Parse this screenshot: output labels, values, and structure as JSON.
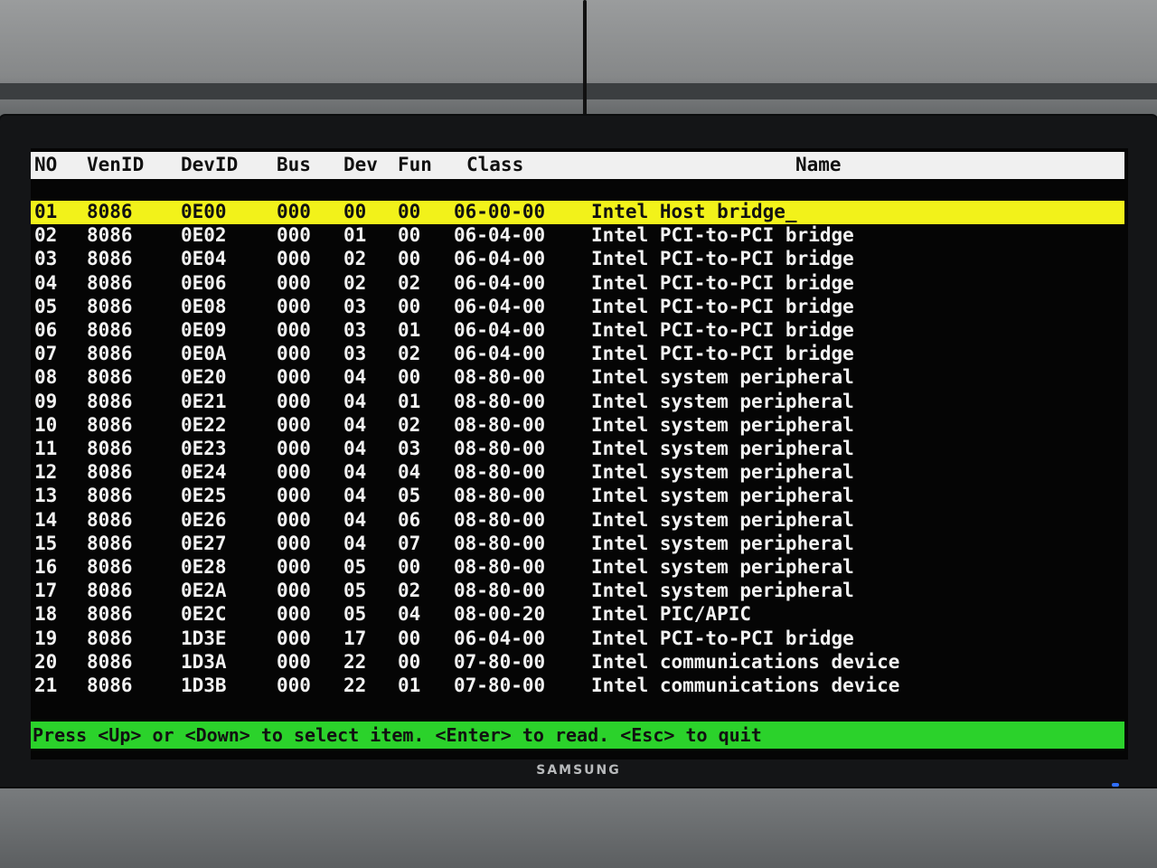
{
  "monitor": {
    "brand": "SAMSUNG"
  },
  "table": {
    "headers": {
      "no": "NO",
      "ven": "VenID",
      "dev": "DevID",
      "bus": "Bus",
      "devno": "Dev",
      "fun": "Fun",
      "class": "Class",
      "name": "Name"
    },
    "selected_index": 0,
    "rows": [
      {
        "no": "01",
        "ven": "8086",
        "dev": "0E00",
        "bus": "000",
        "devno": "00",
        "fun": "00",
        "class": "06-00-00",
        "name": "Intel Host bridge_"
      },
      {
        "no": "02",
        "ven": "8086",
        "dev": "0E02",
        "bus": "000",
        "devno": "01",
        "fun": "00",
        "class": "06-04-00",
        "name": "Intel PCI-to-PCI bridge"
      },
      {
        "no": "03",
        "ven": "8086",
        "dev": "0E04",
        "bus": "000",
        "devno": "02",
        "fun": "00",
        "class": "06-04-00",
        "name": "Intel PCI-to-PCI bridge"
      },
      {
        "no": "04",
        "ven": "8086",
        "dev": "0E06",
        "bus": "000",
        "devno": "02",
        "fun": "02",
        "class": "06-04-00",
        "name": "Intel PCI-to-PCI bridge"
      },
      {
        "no": "05",
        "ven": "8086",
        "dev": "0E08",
        "bus": "000",
        "devno": "03",
        "fun": "00",
        "class": "06-04-00",
        "name": "Intel PCI-to-PCI bridge"
      },
      {
        "no": "06",
        "ven": "8086",
        "dev": "0E09",
        "bus": "000",
        "devno": "03",
        "fun": "01",
        "class": "06-04-00",
        "name": "Intel PCI-to-PCI bridge"
      },
      {
        "no": "07",
        "ven": "8086",
        "dev": "0E0A",
        "bus": "000",
        "devno": "03",
        "fun": "02",
        "class": "06-04-00",
        "name": "Intel PCI-to-PCI bridge"
      },
      {
        "no": "08",
        "ven": "8086",
        "dev": "0E20",
        "bus": "000",
        "devno": "04",
        "fun": "00",
        "class": "08-80-00",
        "name": "Intel system peripheral"
      },
      {
        "no": "09",
        "ven": "8086",
        "dev": "0E21",
        "bus": "000",
        "devno": "04",
        "fun": "01",
        "class": "08-80-00",
        "name": "Intel system peripheral"
      },
      {
        "no": "10",
        "ven": "8086",
        "dev": "0E22",
        "bus": "000",
        "devno": "04",
        "fun": "02",
        "class": "08-80-00",
        "name": "Intel system peripheral"
      },
      {
        "no": "11",
        "ven": "8086",
        "dev": "0E23",
        "bus": "000",
        "devno": "04",
        "fun": "03",
        "class": "08-80-00",
        "name": "Intel system peripheral"
      },
      {
        "no": "12",
        "ven": "8086",
        "dev": "0E24",
        "bus": "000",
        "devno": "04",
        "fun": "04",
        "class": "08-80-00",
        "name": "Intel system peripheral"
      },
      {
        "no": "13",
        "ven": "8086",
        "dev": "0E25",
        "bus": "000",
        "devno": "04",
        "fun": "05",
        "class": "08-80-00",
        "name": "Intel system peripheral"
      },
      {
        "no": "14",
        "ven": "8086",
        "dev": "0E26",
        "bus": "000",
        "devno": "04",
        "fun": "06",
        "class": "08-80-00",
        "name": "Intel system peripheral"
      },
      {
        "no": "15",
        "ven": "8086",
        "dev": "0E27",
        "bus": "000",
        "devno": "04",
        "fun": "07",
        "class": "08-80-00",
        "name": "Intel system peripheral"
      },
      {
        "no": "16",
        "ven": "8086",
        "dev": "0E28",
        "bus": "000",
        "devno": "05",
        "fun": "00",
        "class": "08-80-00",
        "name": "Intel system peripheral"
      },
      {
        "no": "17",
        "ven": "8086",
        "dev": "0E2A",
        "bus": "000",
        "devno": "05",
        "fun": "02",
        "class": "08-80-00",
        "name": "Intel system peripheral"
      },
      {
        "no": "18",
        "ven": "8086",
        "dev": "0E2C",
        "bus": "000",
        "devno": "05",
        "fun": "04",
        "class": "08-00-20",
        "name": "Intel PIC/APIC"
      },
      {
        "no": "19",
        "ven": "8086",
        "dev": "1D3E",
        "bus": "000",
        "devno": "17",
        "fun": "00",
        "class": "06-04-00",
        "name": "Intel PCI-to-PCI bridge"
      },
      {
        "no": "20",
        "ven": "8086",
        "dev": "1D3A",
        "bus": "000",
        "devno": "22",
        "fun": "00",
        "class": "07-80-00",
        "name": "Intel communications device"
      },
      {
        "no": "21",
        "ven": "8086",
        "dev": "1D3B",
        "bus": "000",
        "devno": "22",
        "fun": "01",
        "class": "07-80-00",
        "name": "Intel communications device"
      }
    ]
  },
  "status_bar": {
    "text": "Press <Up> or <Down> to select item. <Enter> to read. <Esc> to quit"
  },
  "colors": {
    "header_bg": "#f0f0f0",
    "selected_bg": "#f2f21a",
    "status_bg": "#2bd22b",
    "text": "#f2f2f2",
    "screen_bg": "#050505"
  }
}
